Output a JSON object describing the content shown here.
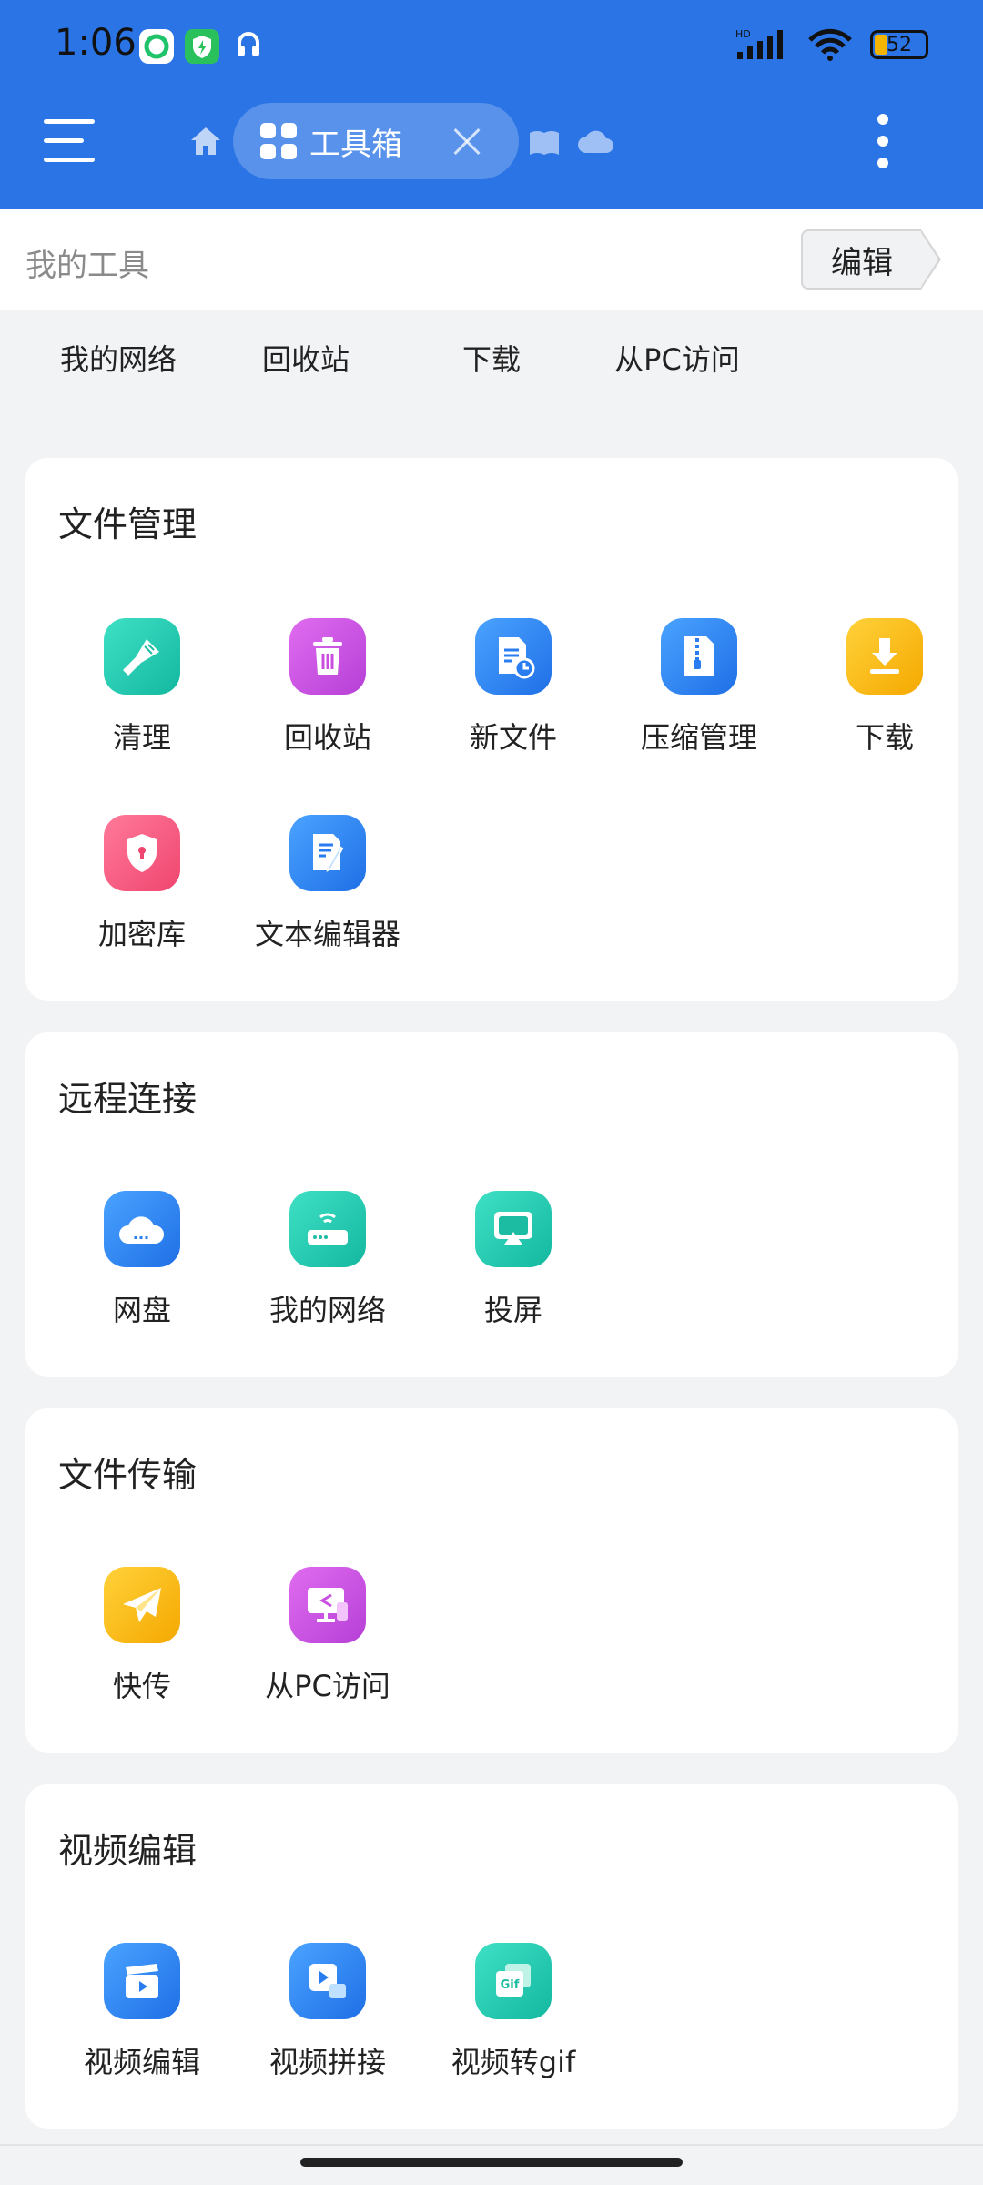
{
  "status_bar": {
    "time": "1:06",
    "battery": "52",
    "network": "HD"
  },
  "header": {
    "tab_label": "工具箱"
  },
  "my_tools": {
    "title": "我的工具",
    "edit_label": "编辑",
    "shortcuts": [
      {
        "label": "我的网络",
        "color": "#1fc7ab"
      },
      {
        "label": "回收站",
        "color": "#c94fe0"
      },
      {
        "label": "下载",
        "color": "#f7b500"
      },
      {
        "label": "从PC访问",
        "color": "#c94fe0"
      }
    ]
  },
  "sections": [
    {
      "title": "文件管理",
      "items": [
        {
          "label": "清理",
          "icon": "broom-icon",
          "color": "teal"
        },
        {
          "label": "回收站",
          "icon": "trash-icon",
          "color": "purple"
        },
        {
          "label": "新文件",
          "icon": "new-file-icon",
          "color": "blue"
        },
        {
          "label": "压缩管理",
          "icon": "zip-icon",
          "color": "blue"
        },
        {
          "label": "下载",
          "icon": "download-icon",
          "color": "yellow"
        },
        {
          "label": "加密库",
          "icon": "shield-lock-icon",
          "color": "pink"
        },
        {
          "label": "文本编辑器",
          "icon": "text-editor-icon",
          "color": "blue"
        }
      ]
    },
    {
      "title": "远程连接",
      "items": [
        {
          "label": "网盘",
          "icon": "cloud-drive-icon",
          "color": "blue"
        },
        {
          "label": "我的网络",
          "icon": "router-icon",
          "color": "teal"
        },
        {
          "label": "投屏",
          "icon": "cast-icon",
          "color": "teal"
        }
      ]
    },
    {
      "title": "文件传输",
      "items": [
        {
          "label": "快传",
          "icon": "paper-plane-icon",
          "color": "yellow"
        },
        {
          "label": "从PC访问",
          "icon": "pc-access-icon",
          "color": "purple"
        }
      ]
    },
    {
      "title": "视频编辑",
      "items": [
        {
          "label": "视频编辑",
          "icon": "clapper-icon",
          "color": "blue"
        },
        {
          "label": "视频拼接",
          "icon": "video-merge-icon",
          "color": "blue"
        },
        {
          "label": "视频转gif",
          "icon": "gif-icon",
          "color": "teal"
        }
      ]
    }
  ]
}
